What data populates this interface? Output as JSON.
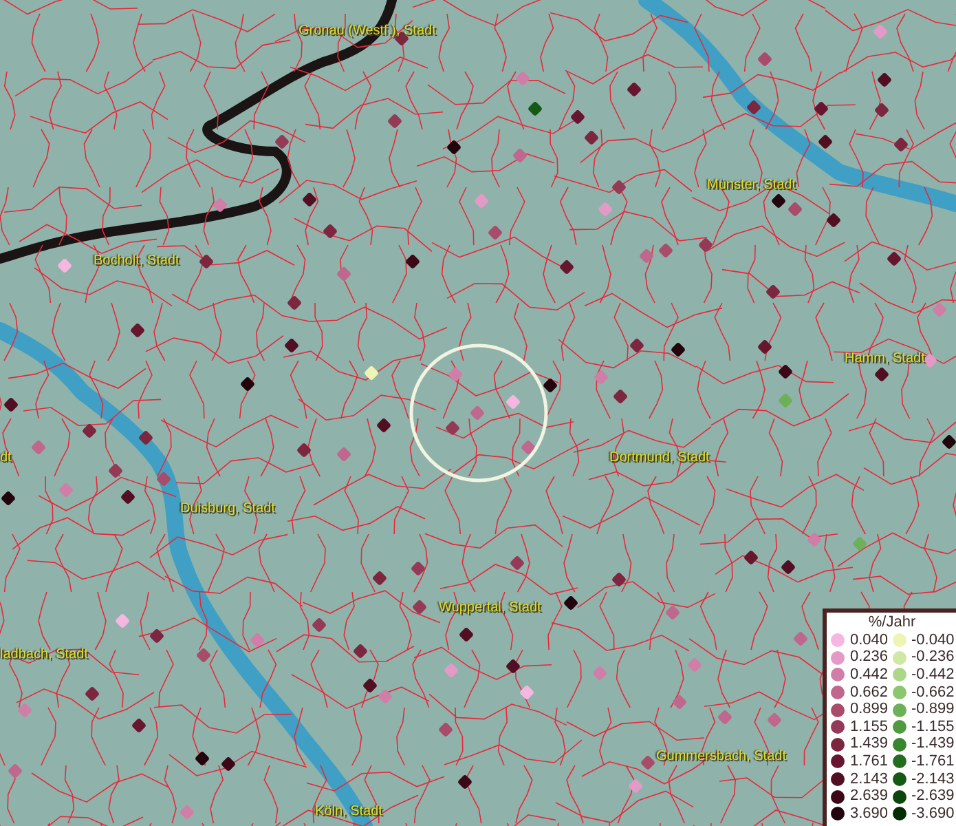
{
  "map": {
    "place_labels": [
      "Gronau (Westf.), Stadt",
      "Münster, Stadt",
      "Bocholt, Stadt",
      "Hamm, Stadt",
      "dt",
      "Dortmund, Stadt",
      "Duisburg, Stadt",
      "Wuppertal, Stadt",
      "ladbach, Stadt",
      "Gummersbach, Stadt",
      "Köln, Stadt"
    ]
  },
  "legend": {
    "title": "%/Jahr",
    "rows": [
      {
        "cells": [
          {
            "label": "0.040",
            "color": "#f5b6e2"
          },
          {
            "label": "-0.040",
            "color": "#eef5b4"
          }
        ]
      },
      {
        "cells": [
          {
            "label": "0.236",
            "color": "#e39ac6"
          },
          {
            "label": "-0.236",
            "color": "#cfe8a6"
          }
        ]
      },
      {
        "cells": [
          {
            "label": "0.442",
            "color": "#d07ea8"
          },
          {
            "label": "-0.442",
            "color": "#acd68a"
          }
        ]
      },
      {
        "cells": [
          {
            "label": "0.662",
            "color": "#bf678c"
          },
          {
            "label": "-0.662",
            "color": "#8cc66e"
          }
        ]
      },
      {
        "cells": [
          {
            "label": "0.899",
            "color": "#a94c6c"
          },
          {
            "label": "-0.899",
            "color": "#6eb05a"
          }
        ]
      },
      {
        "cells": [
          {
            "label": "1.155",
            "color": "#943a56"
          },
          {
            "label": "-1.155",
            "color": "#509a42"
          }
        ]
      },
      {
        "cells": [
          {
            "label": "1.439",
            "color": "#7c2640"
          },
          {
            "label": "-1.439",
            "color": "#3a8630"
          }
        ]
      },
      {
        "cells": [
          {
            "label": "1.761",
            "color": "#681630"
          },
          {
            "label": "-1.761",
            "color": "#226e1e"
          }
        ]
      },
      {
        "cells": [
          {
            "label": "2.143",
            "color": "#520e22"
          },
          {
            "label": "-2.143",
            "color": "#145a14"
          }
        ]
      },
      {
        "cells": [
          {
            "label": "2.639",
            "color": "#3c0818"
          },
          {
            "label": "-2.639",
            "color": "#0c460c"
          }
        ]
      },
      {
        "cells": [
          {
            "label": "3.690",
            "color": "#22040c"
          },
          {
            "label": "-3.690",
            "color": "#062c06"
          }
        ]
      }
    ]
  }
}
